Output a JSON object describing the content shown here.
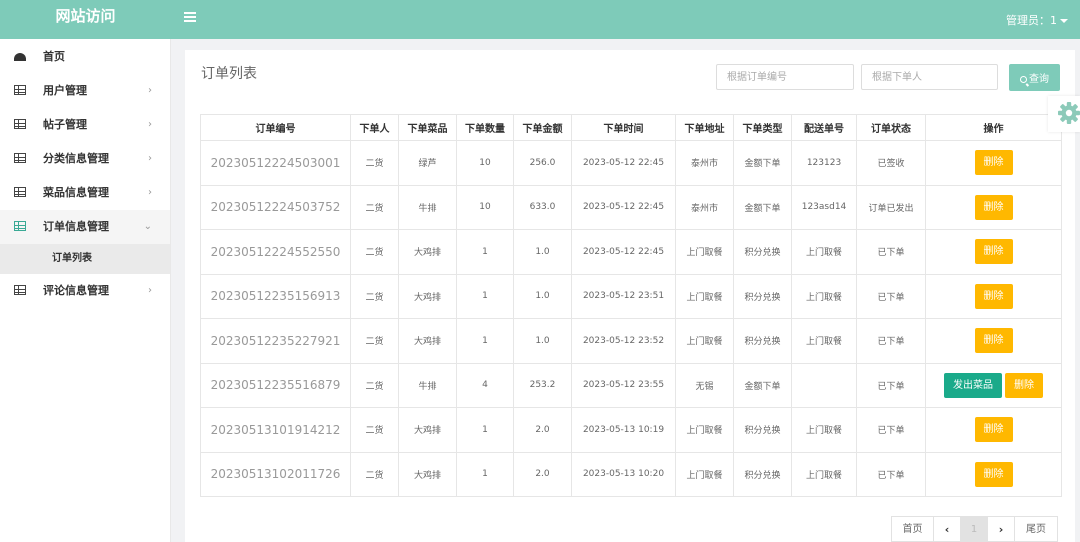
{
  "header": {
    "brand": "网站访问",
    "admin_label": "管理员：1"
  },
  "sidebar": {
    "items": [
      {
        "label": "首页"
      },
      {
        "label": "用户管理"
      },
      {
        "label": "帖子管理"
      },
      {
        "label": "分类信息管理"
      },
      {
        "label": "菜品信息管理"
      },
      {
        "label": "订单信息管理"
      },
      {
        "label": "评论信息管理"
      }
    ],
    "sub_items": [
      {
        "label": "订单列表"
      }
    ]
  },
  "main": {
    "title": "订单列表",
    "search": {
      "order_no_placeholder": "根据订单编号",
      "user_placeholder": "根据下单人",
      "button_label": "查询"
    },
    "table": {
      "headers": [
        "订单编号",
        "下单人",
        "下单菜品",
        "下单数量",
        "下单金额",
        "下单时间",
        "下单地址",
        "下单类型",
        "配送单号",
        "订单状态",
        "操作"
      ],
      "rows": [
        [
          "20230512224503001",
          "二货",
          "绿芦",
          "10",
          "256.0",
          "2023-05-12 22:45",
          "泰州市",
          "金额下单",
          "123123",
          "已签收"
        ],
        [
          "20230512224503752",
          "二货",
          "牛排",
          "10",
          "633.0",
          "2023-05-12 22:45",
          "泰州市",
          "金额下单",
          "123asd14",
          "订单已发出"
        ],
        [
          "20230512224552550",
          "二货",
          "大鸡排",
          "1",
          "1.0",
          "2023-05-12 22:45",
          "上门取餐",
          "积分兑换",
          "上门取餐",
          "已下单"
        ],
        [
          "20230512235156913",
          "二货",
          "大鸡排",
          "1",
          "1.0",
          "2023-05-12 23:51",
          "上门取餐",
          "积分兑换",
          "上门取餐",
          "已下单"
        ],
        [
          "20230512235227921",
          "二货",
          "大鸡排",
          "1",
          "1.0",
          "2023-05-12 23:52",
          "上门取餐",
          "积分兑换",
          "上门取餐",
          "已下单"
        ],
        [
          "20230512235516879",
          "二货",
          "牛排",
          "4",
          "253.2",
          "2023-05-12 23:55",
          "无锡",
          "金额下单",
          "",
          "已下单"
        ],
        [
          "20230513101914212",
          "二货",
          "大鸡排",
          "1",
          "2.0",
          "2023-05-13 10:19",
          "上门取餐",
          "积分兑换",
          "上门取餐",
          "已下单"
        ],
        [
          "20230513102011726",
          "二货",
          "大鸡排",
          "1",
          "2.0",
          "2023-05-13 10:20",
          "上门取餐",
          "积分兑换",
          "上门取餐",
          "已下单"
        ]
      ],
      "delete_label": "删除",
      "ship_label": "发出菜品"
    },
    "pagination": {
      "first": "首页",
      "prev": "‹",
      "current": "1",
      "next": "›",
      "last": "尾页"
    }
  },
  "colors": {
    "accent": "#7ecbb9",
    "delete_button": "#ffb800",
    "ship_button": "#1aaa8a"
  },
  "icons": {
    "menu": "hamburger-icon",
    "settings": "gear-icon",
    "home": "dashboard-icon",
    "nav": "grid-icon"
  }
}
